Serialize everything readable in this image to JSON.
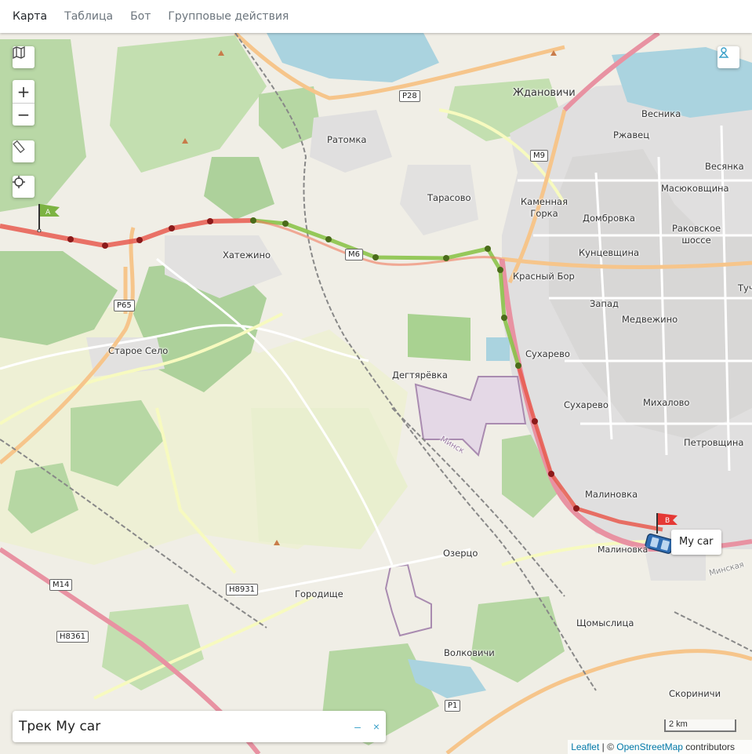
{
  "nav": {
    "tabs": [
      {
        "label": "Карта",
        "active": true
      },
      {
        "label": "Таблица",
        "active": false
      },
      {
        "label": "Бот",
        "active": false
      },
      {
        "label": "Групповые действия",
        "active": false
      }
    ]
  },
  "map_controls": {
    "layers_icon": "map-layers-icon",
    "zoom_in": "+",
    "zoom_out": "−",
    "ruler_icon": "ruler-icon",
    "locate_icon": "crosshair-icon",
    "user_icon": "user-pin-icon"
  },
  "places": [
    "Ждановичи",
    "Весника",
    "Ржавец",
    "Весянка",
    "Ратомка",
    "Масюковщина",
    "Тарасово",
    "Каменная Горка",
    "Домбровка",
    "Раковское шоссе",
    "Кунцевщина",
    "Хатежино",
    "Красный Бор",
    "Запад",
    "Туч",
    "Медвежино",
    "Старое Село",
    "Сухарево",
    "Дегтярёвка",
    "Сухарево",
    "Михалово",
    "Петровщина",
    "Малиновка",
    "Минск",
    "Малиновка",
    "Озерцо",
    "Городище",
    "Щомыслица",
    "Волковичи",
    "Скориничи",
    "Минская"
  ],
  "road_shields": [
    "P28",
    "M9",
    "M6",
    "P65",
    "M14",
    "H8931",
    "H8361",
    "P1"
  ],
  "track": {
    "title": "Трек My car",
    "start_flag": "A",
    "end_flag": "B",
    "vehicle_label": "My car",
    "colors": {
      "fast": "#d9534f",
      "slow": "#8bc34a",
      "point_red": "#8b1a1a",
      "point_green": "#4a6b1a"
    }
  },
  "panel": {
    "title": "Трек My car",
    "minimize": "–",
    "close": "×"
  },
  "scale": "2 km",
  "attribution": {
    "leaflet": "Leaflet",
    "sep": " | © ",
    "osm": "OpenStreetMap",
    "rest": " contributors"
  }
}
